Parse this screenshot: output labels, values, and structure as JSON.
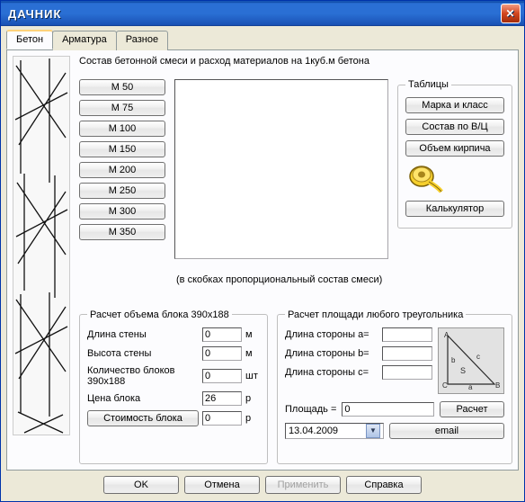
{
  "window": {
    "title": "ДАЧНИК"
  },
  "tabs": {
    "concrete": "Бетон",
    "rebar": "Арматура",
    "misc": "Разное"
  },
  "headline": "Состав бетонной смеси и расход материалов на 1куб.м бетона",
  "grades": [
    "М 50",
    "М 75",
    "М 100",
    "М 150",
    "М 200",
    "М 250",
    "М 300",
    "М 350"
  ],
  "tables_group": {
    "legend": "Таблицы",
    "brand": "Марка и класс",
    "ratio": "Состав по В/Ц",
    "brick": "Объем кирпича",
    "calc": "Калькулятор"
  },
  "footnote": "(в скобках пропорциональный состав смеси)",
  "block": {
    "legend": "Расчет объема блока 390x188",
    "wall_len_label": "Длина стены",
    "wall_len": "0",
    "m": "м",
    "wall_h_label": "Высота стены",
    "wall_h": "0",
    "qty_label": "Количество блоков 390x188",
    "qty": "0",
    "pcs": "шт",
    "price_label": "Цена блока",
    "price": "26",
    "rub": "р",
    "cost_btn": "Стоимость блока",
    "cost": "0"
  },
  "tri": {
    "legend": "Расчет площади любого треугольника",
    "a": "Длина стороны a=",
    "av": "",
    "b": "Длина стороны b=",
    "bv": "",
    "c": "Длина стороны c=",
    "cv": "",
    "area_label": "Площадь =",
    "area": "0",
    "calc_btn": "Расчет"
  },
  "date": "13.04.2009",
  "email_btn": "email",
  "bottom": {
    "ok": "OK",
    "cancel": "Отмена",
    "apply": "Применить",
    "help": "Справка"
  }
}
